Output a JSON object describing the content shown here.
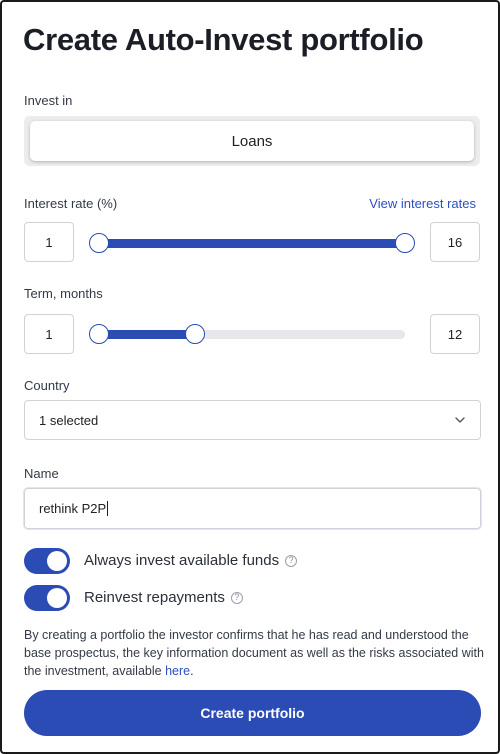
{
  "title": "Create Auto-Invest portfolio",
  "invest_in": {
    "label": "Invest in",
    "value": "Loans"
  },
  "interest_rate": {
    "label": "Interest rate (%)",
    "link": "View interest rates",
    "min": "1",
    "max": "16",
    "range_min": 1,
    "range_max": 16
  },
  "term": {
    "label": "Term, months",
    "min": "1",
    "max": "12",
    "range_min": 1,
    "range_max": 36
  },
  "country": {
    "label": "Country",
    "value": "1 selected",
    "icon": "chevron-down-icon"
  },
  "name": {
    "label": "Name",
    "value": "rethink P2P"
  },
  "toggles": [
    {
      "label": "Always invest available funds",
      "on": true,
      "help_icon": "?"
    },
    {
      "label": "Reinvest repayments",
      "on": true,
      "help_icon": "?"
    }
  ],
  "disclaimer": {
    "text": "By creating a portfolio the investor confirms that he has read and understood the base prospectus, the key information document as well as the risks associated with the investment, available ",
    "link": "here",
    "end": "."
  },
  "cta": {
    "label": "Create portfolio"
  },
  "colors": {
    "accent": "#2b4bb5",
    "link": "#2d4fbf"
  }
}
